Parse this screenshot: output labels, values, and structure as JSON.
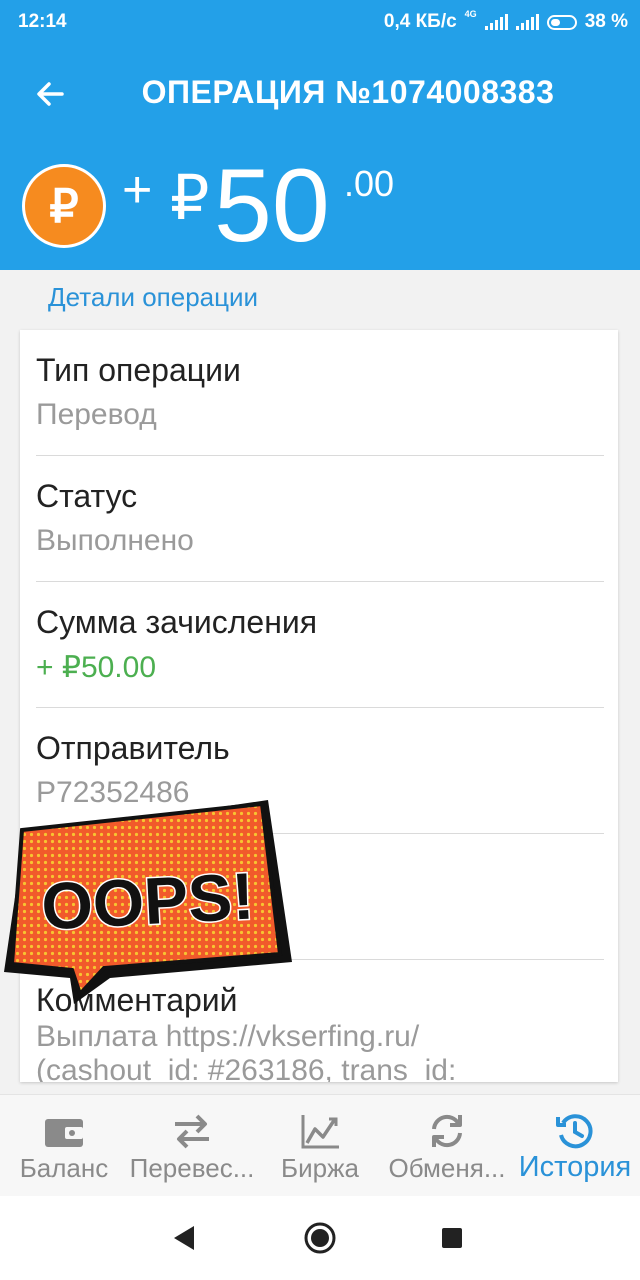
{
  "status_bar": {
    "time": "12:14",
    "speed": "0,4 КБ/с",
    "network": "4G",
    "battery": "38 %"
  },
  "app_bar": {
    "title": "ОПЕРАЦИЯ №1074008383"
  },
  "amount": {
    "coin_symbol": "₽",
    "sign": "+",
    "currency": "₽",
    "integer": "50",
    "cents": ".00"
  },
  "section_title": "Детали операции",
  "details": [
    {
      "label": "Тип операции",
      "value": "Перевод"
    },
    {
      "label": "Статус",
      "value": "Выполнено"
    },
    {
      "label": "Сумма зачисления",
      "value": "+ ₽50.00"
    },
    {
      "label": "Отправитель",
      "value": "P72352486"
    },
    {
      "label": "",
      "value": ""
    },
    {
      "label": "Комментарий",
      "value_line1": "Выплата https://vkserfing.ru/",
      "value_line2": "(cashout_id: #263186, trans_id:"
    }
  ],
  "sticker_text": "OOPS!",
  "bottom_nav": [
    {
      "label": "Баланс",
      "icon": "wallet-icon"
    },
    {
      "label": "Перевес...",
      "icon": "transfer-arrows-icon"
    },
    {
      "label": "Биржа",
      "icon": "chart-icon"
    },
    {
      "label": "Обменя...",
      "icon": "exchange-refresh-icon"
    },
    {
      "label": "История",
      "icon": "history-icon",
      "active": true
    }
  ],
  "colors": {
    "primary": "#23a0e8",
    "accent_text": "#2a92d8",
    "coin": "#f68b1f",
    "positive": "#4caf50",
    "sticker": "#f15a2b"
  }
}
